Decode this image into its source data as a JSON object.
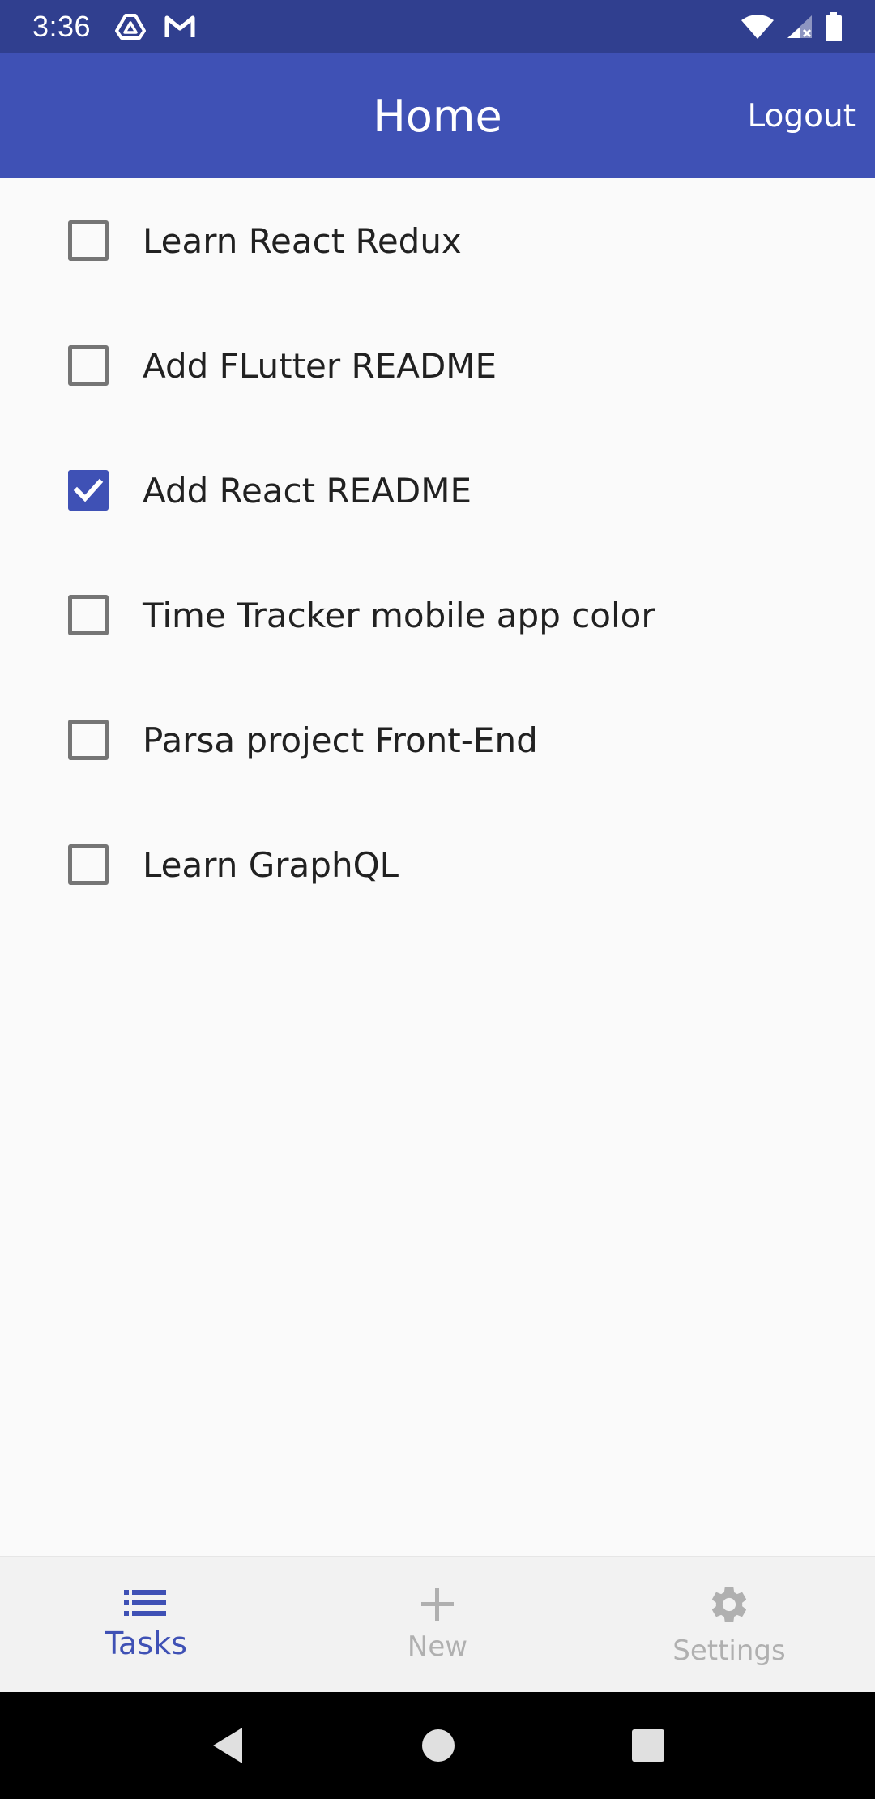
{
  "status_bar": {
    "time": "3:36",
    "notification_icons": [
      "drive-icon",
      "gmail-icon"
    ],
    "right_icons": [
      "wifi-icon",
      "signal-icon",
      "battery-icon"
    ]
  },
  "app_bar": {
    "title": "Home",
    "logout_label": "Logout",
    "color": "#3f51b5"
  },
  "tasks": [
    {
      "label": "Learn React Redux",
      "checked": false
    },
    {
      "label": "Add FLutter README",
      "checked": false
    },
    {
      "label": "Add React README",
      "checked": true
    },
    {
      "label": "Time Tracker mobile app color",
      "checked": false
    },
    {
      "label": "Parsa project Front-End",
      "checked": false
    },
    {
      "label": "Learn GraphQL",
      "checked": false
    }
  ],
  "bottom_nav": {
    "items": [
      {
        "label": "Tasks",
        "icon": "list-icon",
        "active": true
      },
      {
        "label": "New",
        "icon": "plus-icon",
        "active": false
      },
      {
        "label": "Settings",
        "icon": "gear-icon",
        "active": false
      }
    ]
  },
  "system_nav": {
    "icons": [
      "back-icon",
      "home-icon",
      "recents-icon"
    ]
  }
}
